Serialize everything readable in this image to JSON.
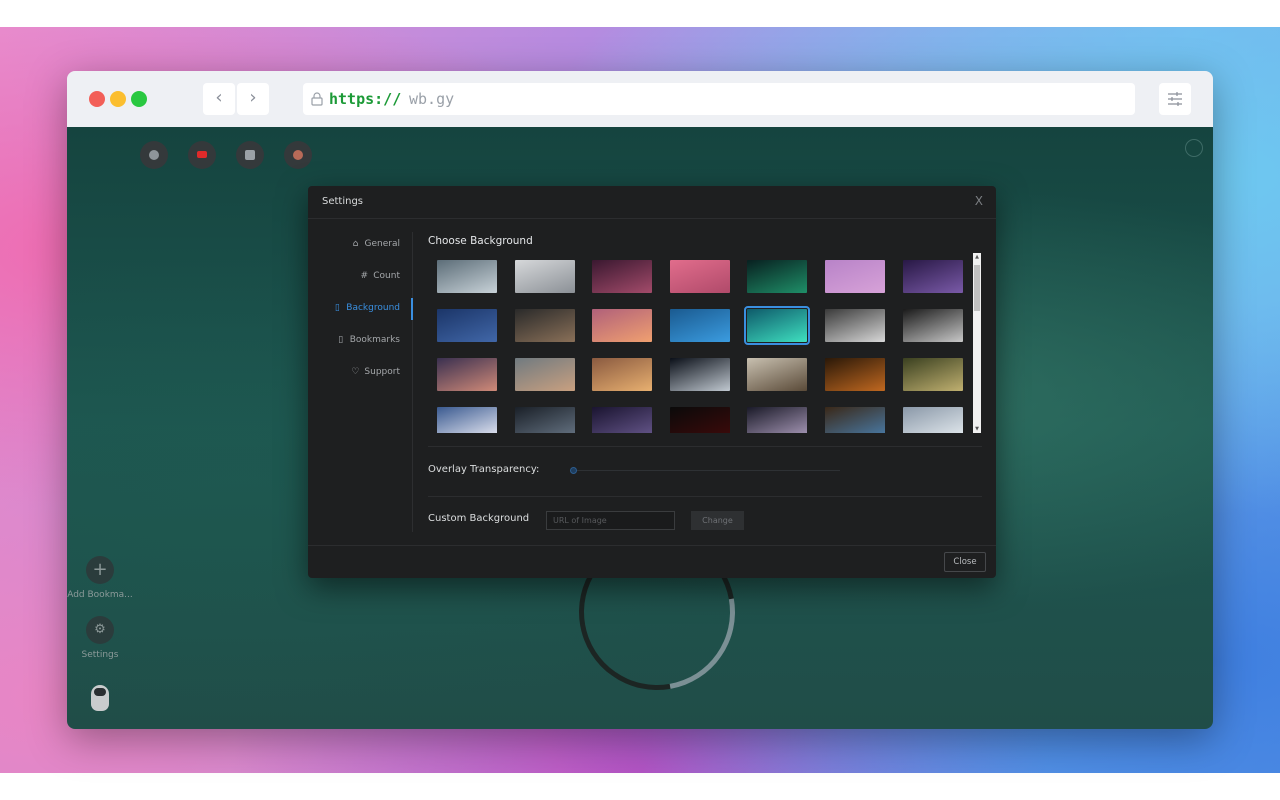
{
  "browser": {
    "url_protocol": "https://",
    "url_host": "wb.gy",
    "back_icon": "chevron-left-icon",
    "forward_icon": "chevron-right-icon",
    "lock_icon": "lock-icon",
    "settings_icon": "sliders-icon"
  },
  "shortcuts": [
    {
      "icon": "globe-icon",
      "color": "#8e959a"
    },
    {
      "icon": "youtube-icon",
      "color": "#e02a2a"
    },
    {
      "icon": "image-icon",
      "color": "#9aa1a6"
    },
    {
      "icon": "avatar-icon",
      "color": "#b86a58"
    }
  ],
  "sidebar": {
    "add_bookmark_label": "Add Bookma...",
    "add_bookmark_icon": "+",
    "settings_label": "Settings",
    "settings_icon": "⚙"
  },
  "modal": {
    "title": "Settings",
    "close_glyph": "X",
    "menu": [
      {
        "label": "General",
        "icon": "⌂",
        "active": false
      },
      {
        "label": "Count",
        "icon": "#",
        "active": false
      },
      {
        "label": "Background",
        "icon": "▯",
        "active": true
      },
      {
        "label": "Bookmarks",
        "icon": "▯",
        "active": false
      },
      {
        "label": "Support",
        "icon": "♡",
        "active": false
      }
    ],
    "choose_background": "Choose Background",
    "overlay_label": "Overlay Transparency:",
    "overlay_value": 0,
    "custom_label": "Custom Background",
    "url_placeholder": "URL of Image",
    "url_value": "",
    "change_label": "Change",
    "close_label": "Close",
    "selected_index": 11,
    "backgrounds": [
      [
        "#5c6d78",
        "#c8d2d8"
      ],
      [
        "#d6d8da",
        "#8b9096"
      ],
      [
        "#3a1830",
        "#a34b6a"
      ],
      [
        "#e16d8c",
        "#b04a6a"
      ],
      [
        "#082020",
        "#1f8f68"
      ],
      [
        "#b883c8",
        "#d7a2d8"
      ],
      [
        "#281845",
        "#7a5aa8"
      ],
      [
        "#1b3568",
        "#4167a8"
      ],
      [
        "#2a2a2a",
        "#8a7058"
      ],
      [
        "#b0607a",
        "#f0a070"
      ],
      [
        "#1a5a90",
        "#3b9ce0"
      ],
      [
        "#0e5a6a",
        "#3fe0c0"
      ],
      [
        "#3a3a3a",
        "#d8d8d8"
      ],
      [
        "#1a1a1a",
        "#c8c8c8"
      ],
      [
        "#3a3050",
        "#d08a78"
      ],
      [
        "#707a80",
        "#c9a080"
      ],
      [
        "#8a5a40",
        "#e8b070"
      ],
      [
        "#0a0f18",
        "#c0c8d0"
      ],
      [
        "#c8c0b0",
        "#5a4a38"
      ],
      [
        "#2a1808",
        "#c06820"
      ],
      [
        "#3a4020",
        "#c0b070"
      ],
      [
        "#3a5a90",
        "#f0f0f8"
      ],
      [
        "#1a2028",
        "#6a7888"
      ],
      [
        "#1a1430",
        "#6a5a90"
      ],
      [
        "#0a0a0a",
        "#400a0a"
      ],
      [
        "#1a1a28",
        "#b0a0c0"
      ],
      [
        "#3a2818",
        "#4a80b0"
      ],
      [
        "#8a98a8",
        "#e8eef2"
      ]
    ]
  }
}
